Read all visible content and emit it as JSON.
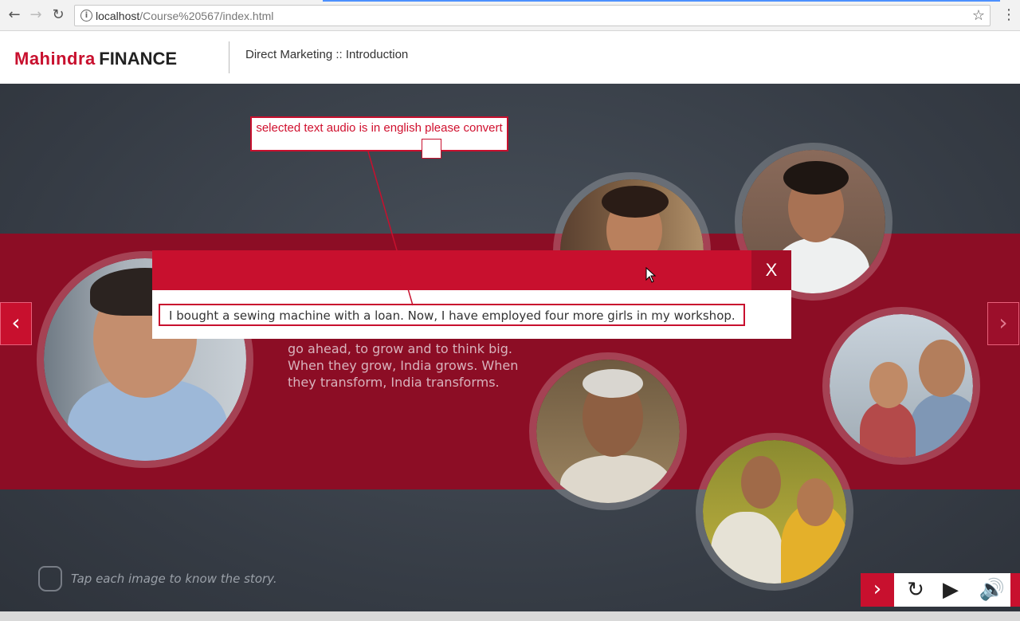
{
  "browser": {
    "url_host": "localhost",
    "url_path": "/Course%20567/index.html",
    "back_icon": "arrow-left-icon",
    "forward_icon": "arrow-right-icon",
    "reload_icon": "reload-icon",
    "bookmark_icon": "star-icon",
    "menu_icon": "kebab-menu-icon"
  },
  "header": {
    "logo_brand": "Mahindra",
    "logo_suffix": "FINANCE",
    "course_title": "Direct Marketing :: Introduction"
  },
  "stage": {
    "body_text": "go ahead, to grow and to think big. When they grow, India grows. When they transform, India transforms.",
    "hint_text": "Tap each image to know the story.",
    "prev_icon": "chevron-left-icon",
    "next_icon": "chevron-right-icon"
  },
  "modal": {
    "close_label": "X",
    "story_text": "I bought a sewing machine with a loan. Now, I have employed four more girls in my workshop."
  },
  "annotation": {
    "text": "selected text audio is in english please convert"
  },
  "toolbar": {
    "next_icon": "chevron-right-icon",
    "replay_icon": "replay-icon",
    "play_icon": "play-icon",
    "audio_icon": "speaker-icon"
  },
  "colors": {
    "brand_red": "#c8102e",
    "band_red": "#8c0d25",
    "stage_bg": "#353b44"
  }
}
